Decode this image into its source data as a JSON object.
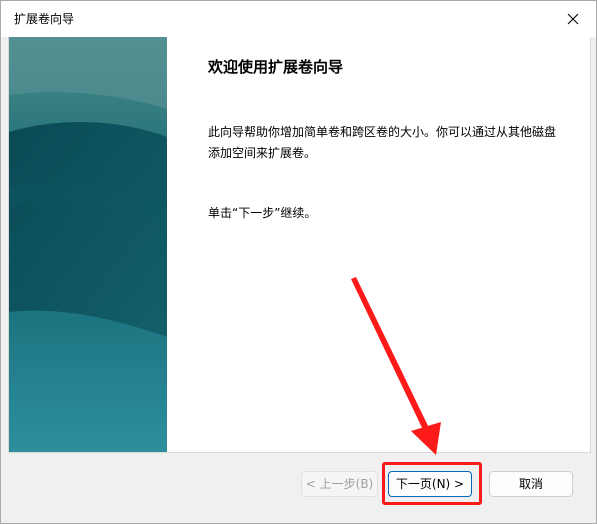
{
  "window": {
    "title": "扩展卷向导"
  },
  "main": {
    "heading": "欢迎使用扩展卷向导",
    "description": "此向导帮助你增加简单卷和跨区卷的大小。你可以通过从其他磁盘添加空间来扩展卷。",
    "hint": "单击“下一步”继续。"
  },
  "buttons": {
    "back_label": "< 上一步(B)",
    "next_label": "下一页(N) >",
    "cancel_label": "取消"
  },
  "icons": {
    "close": "close-icon",
    "annotation_arrow": "arrow-annotation"
  },
  "colors": {
    "annotation": "#ff1a1a",
    "side_graphic_dark": "#0d5560",
    "side_graphic_light": "#2a8a96",
    "default_button_border": "#0067c0"
  }
}
